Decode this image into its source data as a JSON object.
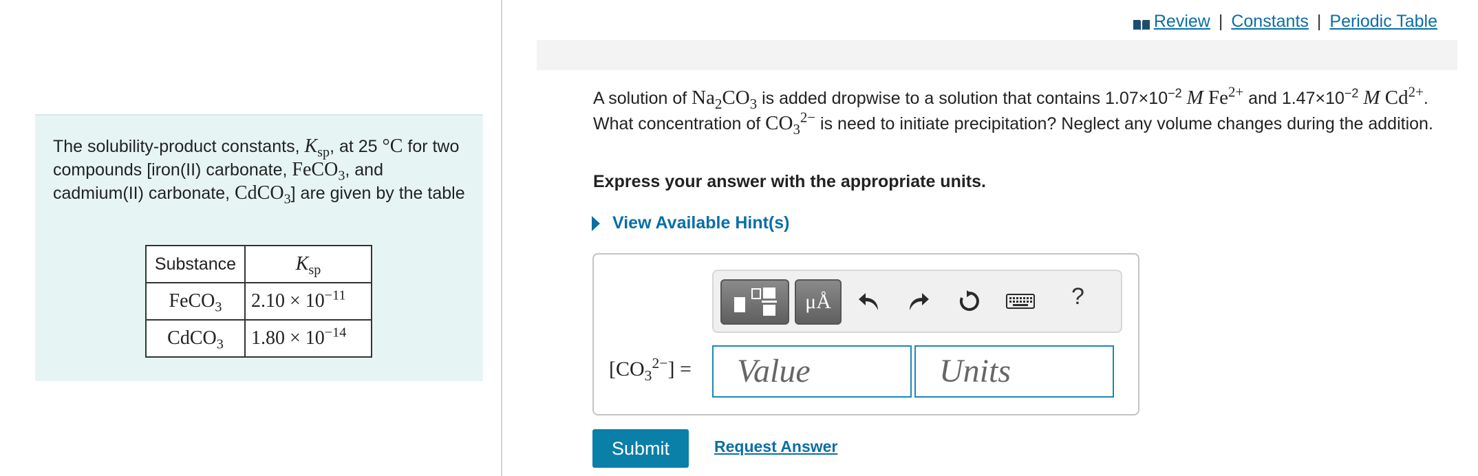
{
  "top_links": {
    "review": "Review",
    "constants": "Constants",
    "periodic_table": "Periodic Table",
    "separator": "|"
  },
  "left_panel": {
    "text_1": "The solubility-product constants, ",
    "ksp_symbol": "K",
    "ksp_sub": "sp",
    "text_2": ", at 25 ",
    "degree": "°C",
    "text_3": " for two compounds [iron(II) carbonate, ",
    "fe_formula": "FeCO",
    "sub_3": "3",
    "text_4": ", and cadmium(II) carbonate, ",
    "cd_formula": "CdCO",
    "text_5": "] are given by the table",
    "table": {
      "header_substance": "Substance",
      "header_k": "K",
      "header_k_sub": "sp",
      "rows": [
        {
          "name": "FeCO",
          "name_sub": "3",
          "mantissa": "2.10 × 10",
          "exponent": "−11"
        },
        {
          "name": "CdCO",
          "name_sub": "3",
          "mantissa": "1.80 × 10",
          "exponent": "−14"
        }
      ]
    }
  },
  "question": {
    "t1": "A solution of ",
    "na": "Na",
    "na_sub": "2",
    "co": "CO",
    "co_sub": "3",
    "t2": " is added dropwise to a solution that contains 1.07×10",
    "exp1": "−2",
    "m": "M",
    "fe": "Fe",
    "fe_sup": "2+",
    "t3": " and 1.47×10",
    "exp2": "−2",
    "cd": "Cd",
    "cd_sup": "2+",
    "t4": ". What concentration of ",
    "co3": "CO",
    "co3_sub": "3",
    "co3_sup": "2−",
    "t5": " is need to initiate precipitation? Neglect any volume changes during the addition."
  },
  "instruction": "Express your answer with the appropriate units.",
  "hint_link": "View Available Hint(s)",
  "answer": {
    "label_open": "[CO",
    "label_sub": "3",
    "label_sup": "2−",
    "label_close": "] =",
    "value_placeholder": "Value",
    "units_placeholder": "Units",
    "units_button": "μÅ",
    "help": "?"
  },
  "submit_label": "Submit",
  "request_answer_label": "Request Answer",
  "colors": {
    "accent": "#0a7fa7",
    "panel_bg": "#e6f5f4",
    "field_border": "#1a86b8"
  }
}
